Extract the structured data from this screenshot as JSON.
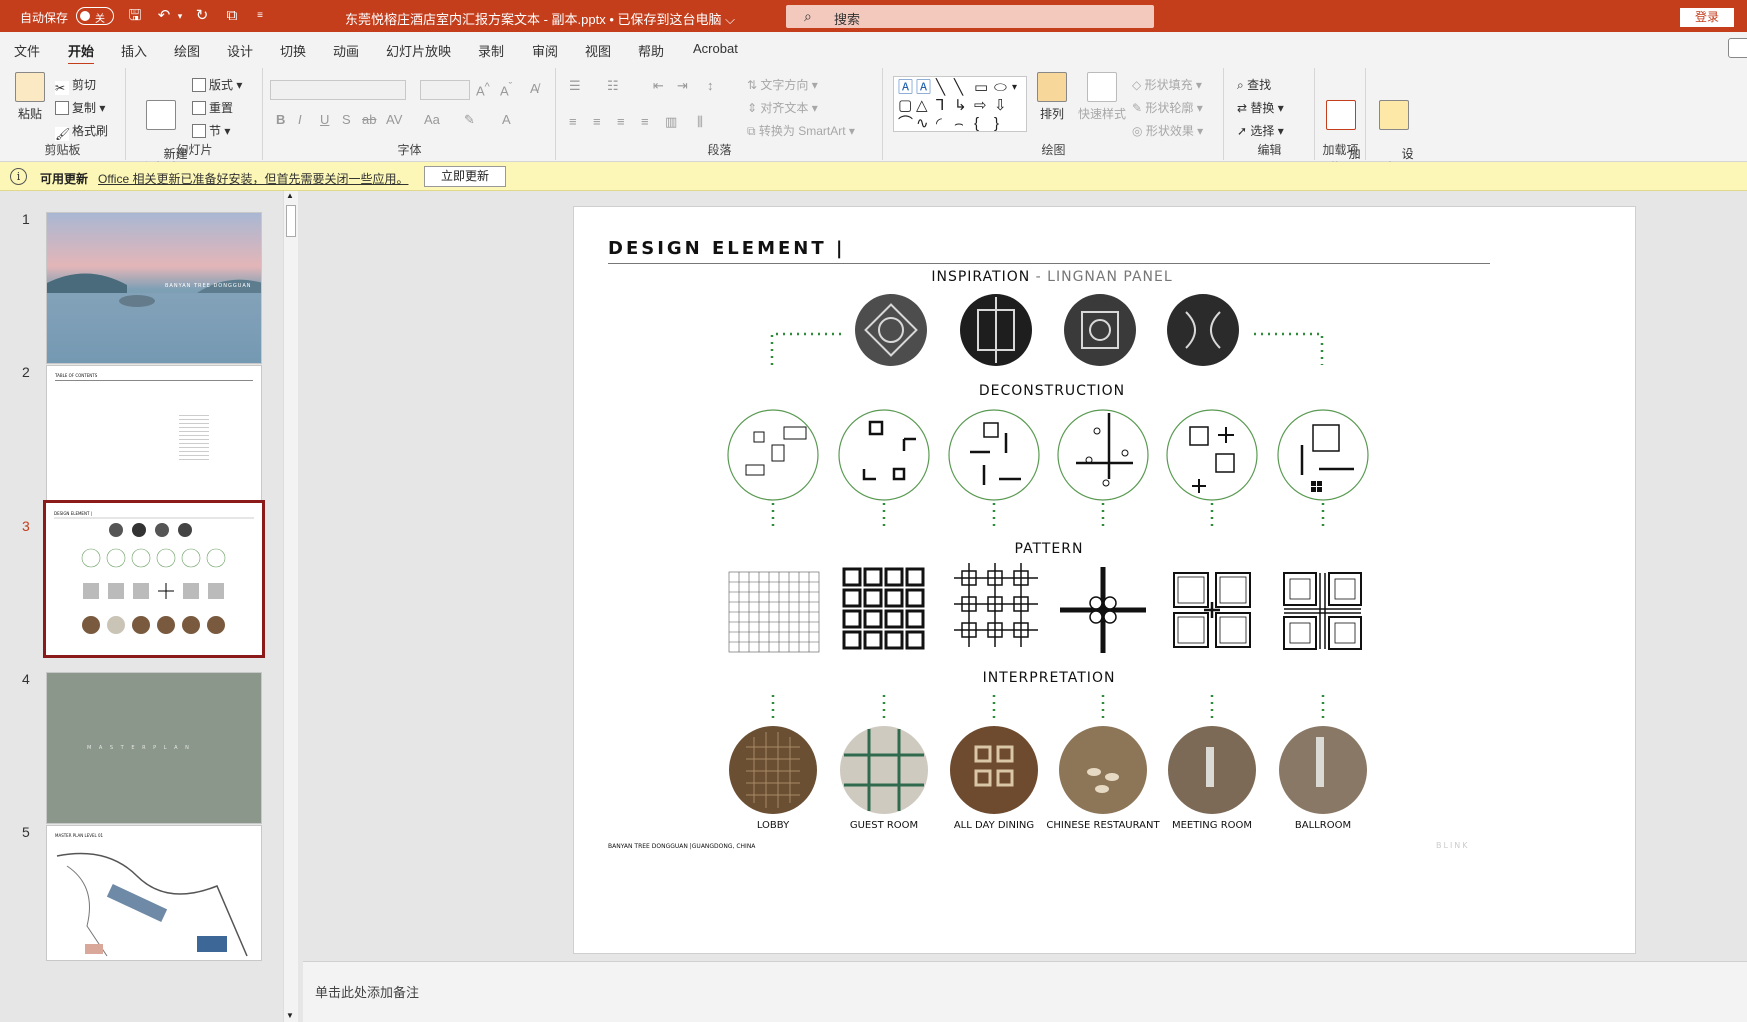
{
  "titlebar": {
    "autosave_label": "自动保存",
    "autosave_state": "关",
    "document_title": "东莞悦榕庄酒店室内汇报方案文本 - 副本.pptx • 已保存到这台电脑 ⌵",
    "search_placeholder": "搜索",
    "login_label": "登录"
  },
  "menu": {
    "tabs": [
      "文件",
      "开始",
      "插入",
      "绘图",
      "设计",
      "切换",
      "动画",
      "幻灯片放映",
      "录制",
      "审阅",
      "视图",
      "帮助",
      "Acrobat"
    ],
    "active": "开始"
  },
  "ribbon": {
    "clipboard": {
      "label": "剪贴板",
      "paste": "粘贴",
      "cut": "剪切",
      "copy": "复制",
      "format_painter": "格式刷"
    },
    "slides": {
      "label": "幻灯片",
      "new_slide": "新建\n幻灯片",
      "layout": "版式",
      "reset": "重置",
      "section": "节"
    },
    "font": {
      "label": "字体"
    },
    "paragraph": {
      "label": "段落",
      "text_direction": "文字方向",
      "align_text": "对齐文本",
      "smartart": "转换为 SmartArt"
    },
    "drawing": {
      "label": "绘图",
      "arrange": "排列",
      "quick_styles": "快速样式",
      "shape_fill": "形状填充",
      "shape_outline": "形状轮廓",
      "shape_effects": "形状效果"
    },
    "editing": {
      "label": "编辑",
      "find": "查找",
      "replace": "替换",
      "select": "选择"
    },
    "addins": {
      "label": "加载项",
      "addins_btn": "加\n载项"
    },
    "designer": {
      "label": "设\n计器"
    }
  },
  "notification": {
    "title": "可用更新",
    "message": "Office 相关更新已准备好安装，但首先需要关闭一些应用。",
    "button": "立即更新"
  },
  "thumbnails": {
    "numbers": [
      "1",
      "2",
      "3",
      "4",
      "5"
    ],
    "active_index": 3,
    "slide1_title": "BANYAN TREE DONGGUAN",
    "slide2_title": "TABLE OF CONTENTS",
    "slide3_title": "DESIGN ELEMENT |",
    "slide4_title": "M A S T E R   P L A N",
    "slide5_title": "MASTER PLAN  LEVEL 01"
  },
  "slide": {
    "title": "DESIGN ELEMENT  |",
    "inspiration_label": "INSPIRATION",
    "inspiration_sub": " - LINGNAN PANEL",
    "deconstruction_label": "DECONSTRUCTION",
    "pattern_label": "PATTERN",
    "interpretation_label": "INTERPRETATION",
    "rooms": [
      "LOBBY",
      "GUEST ROOM",
      "ALL DAY DINING",
      "CHINESE RESTAURANT",
      "MEETING ROOM",
      "BALLROOM"
    ],
    "footer": "BANYAN TREE DONGGUAN |GUANGDONG, CHINA",
    "watermark": "BLINK"
  },
  "notes": {
    "placeholder": "单击此处添加备注"
  },
  "colors": {
    "accent": "#c43e1c",
    "dotted_green": "#2e8b3a",
    "circle_green": "#5a9a52"
  }
}
